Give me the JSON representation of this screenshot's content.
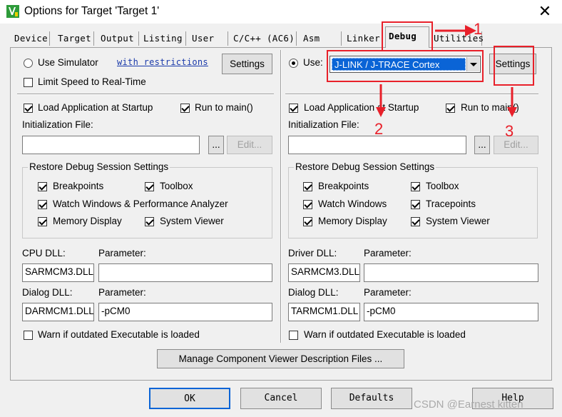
{
  "window": {
    "title": "Options for Target 'Target 1'",
    "close": "✕"
  },
  "tabs": [
    "Device",
    "Target",
    "Output",
    "Listing",
    "User",
    "C/C++ (AC6)",
    "Asm",
    "Linker",
    "Debug",
    "Utilities"
  ],
  "active_tab": "Debug",
  "left": {
    "use_simulator": "Use Simulator",
    "with_restrictions": "with restrictions",
    "settings_button": "Settings",
    "limit_speed": "Limit Speed to Real-Time",
    "load_app": "Load Application at Startup",
    "run_to_main": "Run to main()",
    "init_file_label": "Initialization File:",
    "init_file_value": "",
    "browse": "...",
    "edit": "Edit...",
    "restore_title": "Restore Debug Session Settings",
    "restore": {
      "breakpoints": "Breakpoints",
      "toolbox": "Toolbox",
      "watch": "Watch Windows & Performance Analyzer",
      "memory": "Memory Display",
      "system_viewer": "System Viewer"
    },
    "cpu_dll_label": "CPU DLL:",
    "cpu_dll_value": "SARMCM3.DLL",
    "cpu_param_label": "Parameter:",
    "cpu_param_value": "",
    "dialog_dll_label": "Dialog DLL:",
    "dialog_dll_value": "DARMCM1.DLL",
    "dialog_param_label": "Parameter:",
    "dialog_param_value": "-pCM0",
    "warn_outdated": "Warn if outdated Executable is loaded"
  },
  "right": {
    "use": "Use:",
    "debugger_selected": "J-LINK / J-TRACE Cortex",
    "settings_button": "Settings",
    "load_app": "Load Application at Startup",
    "run_to_main": "Run to main()",
    "init_file_label": "Initialization File:",
    "init_file_value": "",
    "browse": "...",
    "edit": "Edit...",
    "restore_title": "Restore Debug Session Settings",
    "restore": {
      "breakpoints": "Breakpoints",
      "toolbox": "Toolbox",
      "watch": "Watch Windows",
      "tracepoints": "Tracepoints",
      "memory": "Memory Display",
      "system_viewer": "System Viewer"
    },
    "driver_dll_label": "Driver DLL:",
    "driver_dll_value": "SARMCM3.DLL",
    "driver_param_label": "Parameter:",
    "driver_param_value": "",
    "dialog_dll_label": "Dialog DLL:",
    "dialog_dll_value": "TARMCM1.DLL",
    "dialog_param_label": "Parameter:",
    "dialog_param_value": "-pCM0",
    "warn_outdated": "Warn if outdated Executable is loaded"
  },
  "manage_button": "Manage Component Viewer Description Files ...",
  "footer": {
    "ok": "OK",
    "cancel": "Cancel",
    "defaults": "Defaults",
    "help": "Help"
  },
  "annotations": {
    "n1": "1",
    "n2": "2",
    "n3": "3",
    "color": "#e8202a"
  },
  "watermark": "CSDN @Earnest kitten"
}
